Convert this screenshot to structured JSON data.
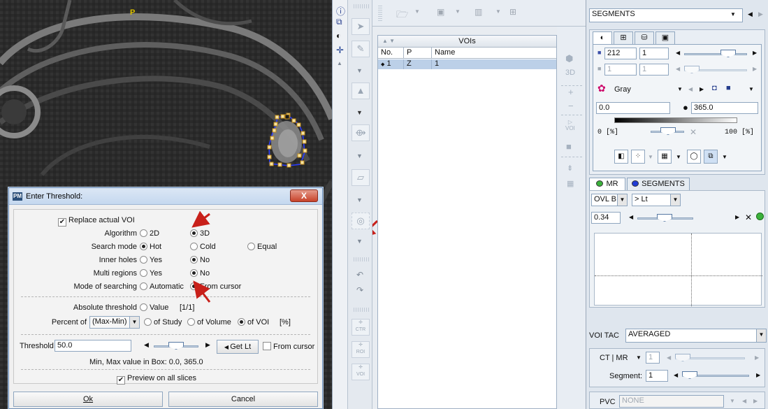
{
  "viewer": {
    "orientation_label": "P"
  },
  "dialog": {
    "title": "Enter Threshold:",
    "close_label": "X",
    "replace_label": "Replace actual VOI",
    "algorithm": {
      "label": "Algorithm",
      "options": [
        "2D",
        "3D"
      ],
      "selected": "3D"
    },
    "search_mode": {
      "label": "Search mode",
      "options": [
        "Hot",
        "Cold",
        "Equal"
      ],
      "selected": "Hot"
    },
    "inner_holes": {
      "label": "Inner holes",
      "options": [
        "Yes",
        "No"
      ],
      "selected": "No"
    },
    "multi_regions": {
      "label": "Multi regions",
      "options": [
        "Yes",
        "No"
      ],
      "selected": "No"
    },
    "mode_of_searching": {
      "label": "Mode of searching",
      "options": [
        "Automatic",
        "From cursor"
      ],
      "selected": "From cursor"
    },
    "absolute_threshold": {
      "label": "Absolute threshold",
      "value_label": "Value",
      "unit": "[1/1]"
    },
    "percent_of": {
      "label": "Percent of",
      "combo_value": "(Max-Min)",
      "options": [
        "of Study",
        "of Volume",
        "of VOI"
      ],
      "selected": "of VOI",
      "unit": "[%]"
    },
    "threshold": {
      "label": "Threshold",
      "value": "50.0",
      "getlt_label": "Get Lt",
      "from_cursor_label": "From cursor",
      "slider_fraction": 0.5
    },
    "minmax_text": "Min, Max value in Box: 0.0, 365.0",
    "preview_label": "Preview on all slices",
    "ok_label": "Ok",
    "cancel_label": "Cancel"
  },
  "voi_panel": {
    "header": "VOIs",
    "columns": [
      "No.",
      "P",
      "Name"
    ],
    "rows": [
      {
        "no": "1",
        "p": "Z",
        "name": "1"
      }
    ],
    "side_3d": "3D",
    "side_voi": "VOI"
  },
  "toolbar_icons": {
    "ctr": "CTR",
    "roi": "ROI",
    "voi": "VOI"
  },
  "right_panel": {
    "combo_title": "SEGMENTS",
    "window_value": "212",
    "window_step": "1",
    "window_value2": "1",
    "window_step2": "1",
    "colormap": "Gray",
    "min_value": "0.0",
    "max_value": "365.0",
    "range_min_label": "0 [%]",
    "range_max_label": "100 [%]",
    "tab_mr": "MR",
    "tab_segments": "SEGMENTS",
    "ovl_combo": "OVL B",
    "lt_combo": "> Lt",
    "ovl_value": "0.34",
    "voi_tac_label": "VOI TAC",
    "voi_tac_value": "AVERAGED",
    "ctmr_label": "CT | MR",
    "ctmr_value": "1",
    "segment_label": "Segment:",
    "segment_value": "1",
    "pvc_label": "PVC",
    "pvc_value": "NONE"
  }
}
